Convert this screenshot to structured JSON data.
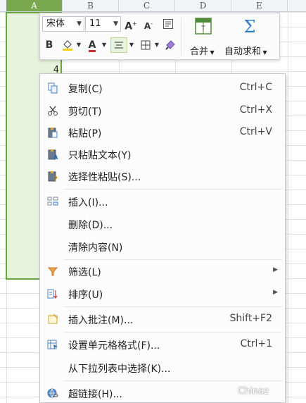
{
  "columns": [
    "A",
    "B",
    "C",
    "D",
    "E"
  ],
  "cell_value": "4",
  "toolbar": {
    "font_name": "宋体",
    "font_size": "11",
    "grow_font": "A",
    "shrink_font": "A",
    "merge_label": "合并",
    "autosum_label": "自动求和",
    "bold_label": "B",
    "font_color_label": "A",
    "accent_red": "#d62b2b",
    "fill_yellow": "#f3d11c"
  },
  "menu": {
    "items": [
      {
        "label": "复制(C)",
        "shortcut": "Ctrl+C",
        "icon": "copy-icon"
      },
      {
        "label": "剪切(T)",
        "shortcut": "Ctrl+X",
        "icon": "scissors-icon"
      },
      {
        "label": "粘贴(P)",
        "shortcut": "Ctrl+V",
        "icon": "paste-icon"
      },
      {
        "label": "只粘贴文本(Y)",
        "shortcut": "",
        "icon": "paste-text-icon"
      },
      {
        "label": "选择性粘贴(S)...",
        "shortcut": "",
        "icon": "paste-special-icon"
      },
      {
        "label": "插入(I)...",
        "shortcut": "",
        "icon": "insert-icon"
      },
      {
        "label": "删除(D)...",
        "shortcut": "",
        "icon": ""
      },
      {
        "label": "清除内容(N)",
        "shortcut": "",
        "icon": ""
      },
      {
        "label": "筛选(L)",
        "shortcut": "",
        "icon": "filter-icon"
      },
      {
        "label": "排序(U)",
        "shortcut": "",
        "icon": "sort-icon"
      },
      {
        "label": "插入批注(M)...",
        "shortcut": "Shift+F2",
        "icon": "comment-icon"
      },
      {
        "label": "设置单元格格式(F)...",
        "shortcut": "Ctrl+1",
        "icon": "format-cells-icon"
      },
      {
        "label": "从下拉列表中选择(K)...",
        "shortcut": "",
        "icon": ""
      },
      {
        "label": "超链接(H)...",
        "shortcut": "",
        "icon": "hyperlink-icon"
      }
    ]
  },
  "watermark": "Chinaz"
}
